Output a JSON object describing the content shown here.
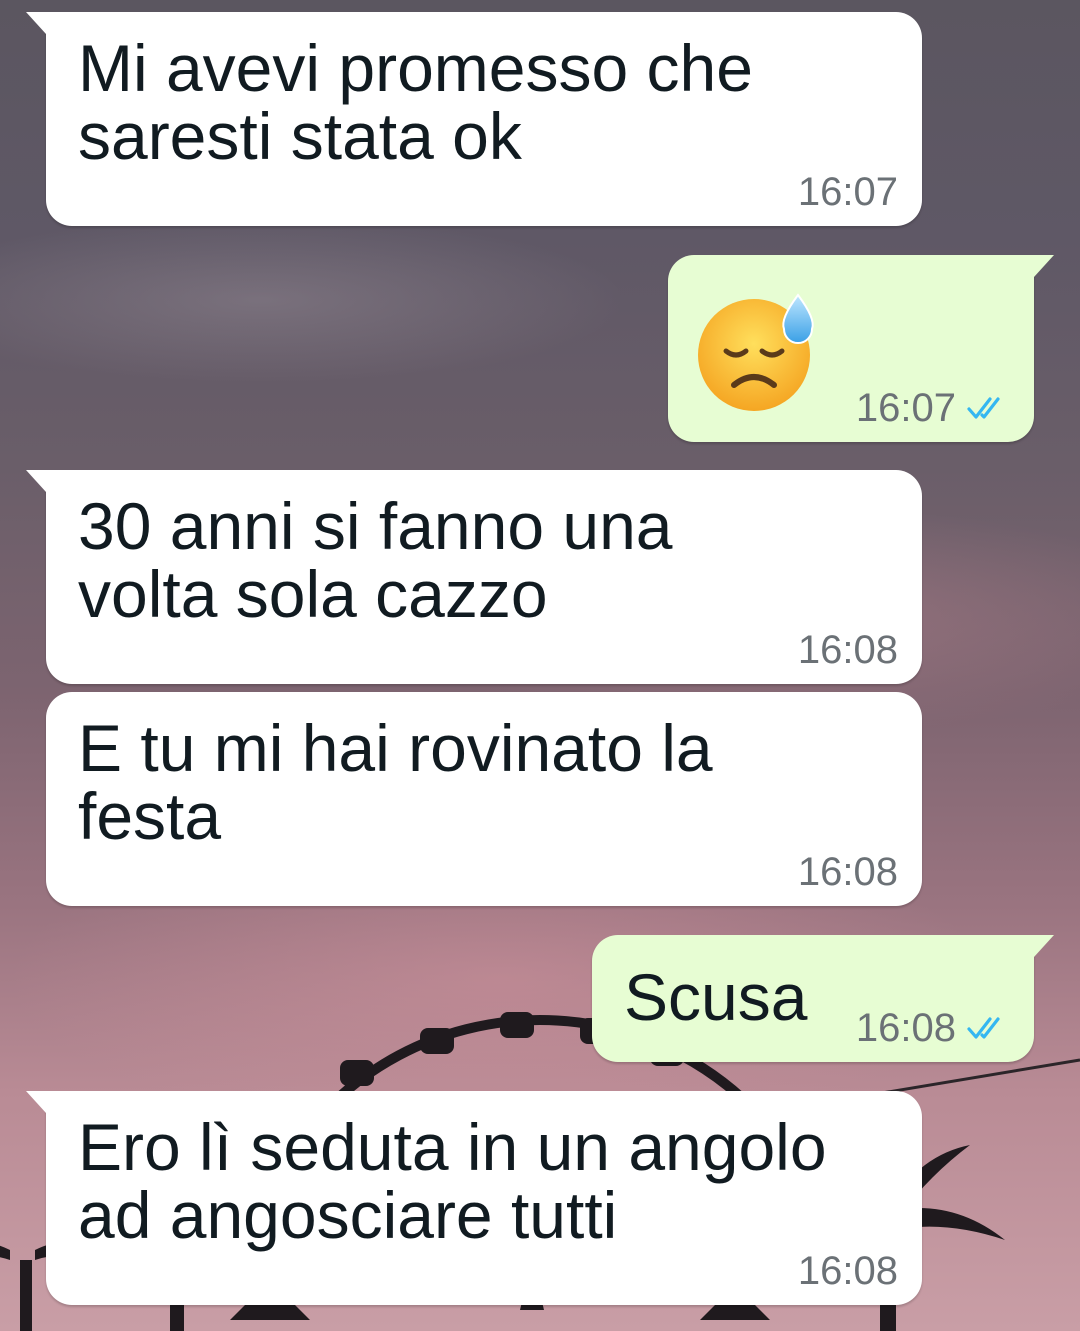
{
  "theme": {
    "incoming_bubble": "#ffffff",
    "outgoing_bubble": "#e7fdd3",
    "text_color": "#111b21",
    "time_color": "#6b7176",
    "read_tick_color": "#34b7f1"
  },
  "messages": [
    {
      "direction": "incoming",
      "text": "Mi avevi promesso che\nsaresti stata ok",
      "time": "16:07"
    },
    {
      "direction": "outgoing",
      "emoji": "downcast-face-with-sweat-emoji",
      "time": "16:07",
      "status": "read",
      "status_icon": "double-check-icon"
    },
    {
      "direction": "incoming",
      "text": "30 anni si fanno una\nvolta sola cazzo",
      "time": "16:08"
    },
    {
      "direction": "incoming",
      "text": "E tu mi hai rovinato la\nfesta",
      "time": "16:08"
    },
    {
      "direction": "outgoing",
      "text": "Scusa",
      "time": "16:08",
      "status": "read",
      "status_icon": "double-check-icon"
    },
    {
      "direction": "incoming",
      "text": "Ero lì seduta in un angolo\nad angosciare tutti",
      "time": "16:08"
    }
  ]
}
